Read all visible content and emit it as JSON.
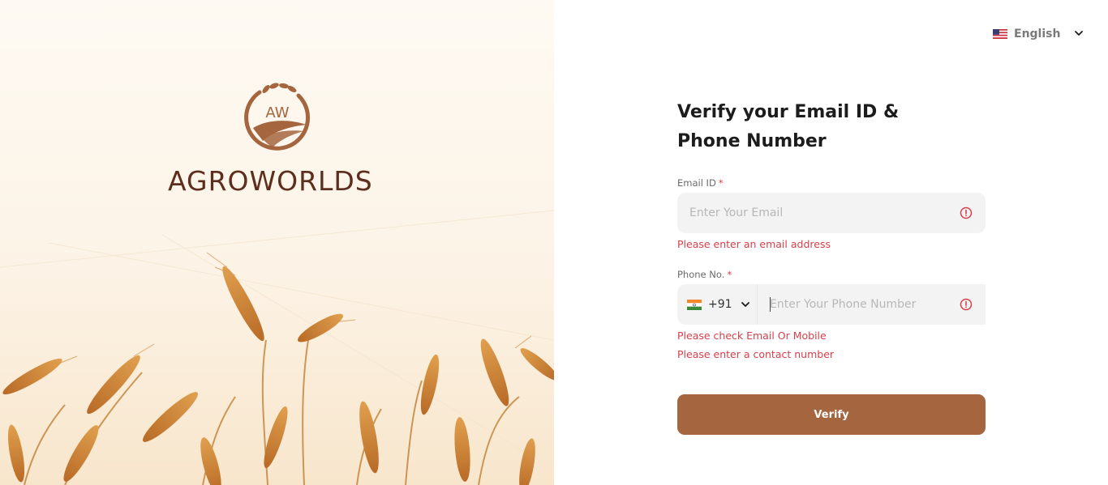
{
  "brand": {
    "monogram": "AW",
    "name": "AGROWORLDS",
    "color": "#5d2e1e",
    "accent": "#a5653f"
  },
  "language": {
    "label": "English",
    "flag_icon": "us-flag-icon"
  },
  "form": {
    "title": "Verify your Email ID & Phone Number",
    "email": {
      "label": "Email ID",
      "required_mark": "*",
      "placeholder": "Enter Your Email",
      "value": "",
      "error": "Please enter an email address"
    },
    "phone": {
      "label": "Phone No.",
      "required_mark": "*",
      "country_code": "+91",
      "country_flag_icon": "india-flag-icon",
      "placeholder": "Enter Your Phone Number",
      "value": "",
      "errors": [
        "Please check Email Or Mobile",
        "Please enter a contact number"
      ]
    },
    "submit_label": "Verify",
    "error_color": "#d6404b"
  }
}
